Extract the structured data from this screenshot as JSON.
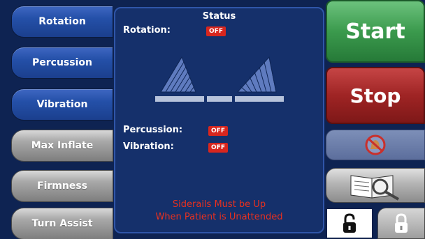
{
  "left_buttons": {
    "rotation": "Rotation",
    "percussion": "Percussion",
    "vibration": "Vibration",
    "max_inflate": "Max Inflate",
    "firmness": "Firmness",
    "turn_assist": "Turn Assist"
  },
  "status_panel": {
    "title": "Status",
    "rotation_label": "Rotation:",
    "rotation_state": "OFF",
    "percussion_label": "Percussion:",
    "percussion_state": "OFF",
    "vibration_label": "Vibration:",
    "vibration_state": "OFF",
    "warning_line1": "Siderails Must be Up",
    "warning_line2": "When Patient is Unattended"
  },
  "right_buttons": {
    "start": "Start",
    "stop": "Stop",
    "mute_icon": "muted-bell-icon",
    "manual_icon": "manual-magnifier-icon",
    "unlock_icon": "unlocked-padlock-icon",
    "lock_icon": "locked-padlock-icon"
  },
  "colors": {
    "background": "#0e2352",
    "panel": "#15306b",
    "off_badge": "#d8261e",
    "warning_text": "#e8311f",
    "start_green": "#3b9a4d",
    "stop_red": "#9f2424"
  }
}
